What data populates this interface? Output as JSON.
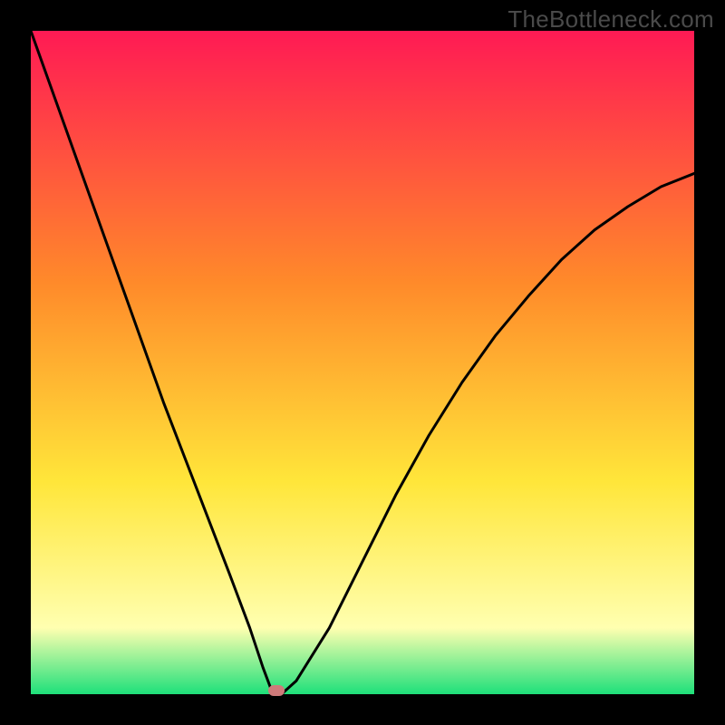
{
  "watermark": "TheBottleneck.com",
  "chart_data": {
    "type": "line",
    "title": "",
    "xlabel": "",
    "ylabel": "",
    "xlim": [
      0,
      100
    ],
    "ylim": [
      0,
      100
    ],
    "grid": false,
    "legend": false,
    "series": [
      {
        "name": "bottleneck-curve",
        "x": [
          0,
          5,
          10,
          15,
          20,
          25,
          30,
          33,
          35,
          36.5,
          38,
          40,
          45,
          50,
          55,
          60,
          65,
          70,
          75,
          80,
          85,
          90,
          95,
          100
        ],
        "y": [
          100,
          86,
          72,
          58,
          44,
          31,
          18,
          10,
          4,
          0,
          0.2,
          2,
          10,
          20,
          30,
          39,
          47,
          54,
          60,
          65.5,
          70,
          73.5,
          76.5,
          78.5
        ]
      }
    ],
    "annotations": [
      {
        "name": "minimum-marker",
        "x": 37,
        "y": 0,
        "color": "#cf7a7a"
      }
    ],
    "background_gradient": {
      "top": "#ff1a54",
      "mid1": "#ff8a2a",
      "mid2": "#ffe63a",
      "pale": "#ffffb0",
      "bottom": "#1ee07a"
    }
  }
}
